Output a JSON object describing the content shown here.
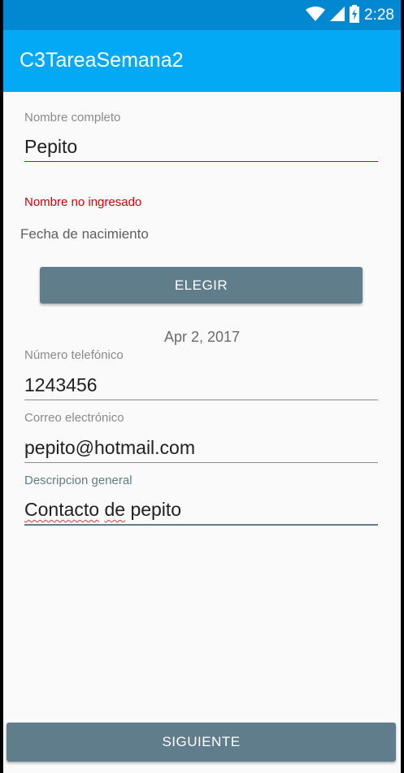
{
  "status_bar": {
    "time": "2:28",
    "icons": [
      "wifi-icon",
      "signal-icon",
      "battery-icon"
    ]
  },
  "app_bar": {
    "title": "C3TareaSemana2"
  },
  "form": {
    "nombre": {
      "label": "Nombre completo",
      "value": "Pepito",
      "error": "Nombre no ingresado"
    },
    "fecha": {
      "label": "Fecha de nacimiento",
      "button": "ELEGIR",
      "selected": "Apr 2, 2017"
    },
    "telefono": {
      "label": "Número telefónico",
      "value": "1243456"
    },
    "correo": {
      "label": "Correo electrónico",
      "value": "pepito@hotmail.com"
    },
    "descripcion": {
      "label": "Descripcion general",
      "value_word1": "Contacto",
      "value_word2": "de",
      "value_word3": "pepito"
    }
  },
  "footer": {
    "next_button": "SIGUIENTE"
  },
  "colors": {
    "status_bar": "#0288d1",
    "app_bar": "#03a9f4",
    "button": "#607d8b",
    "error": "#d50000",
    "focus": "#607d8b"
  }
}
